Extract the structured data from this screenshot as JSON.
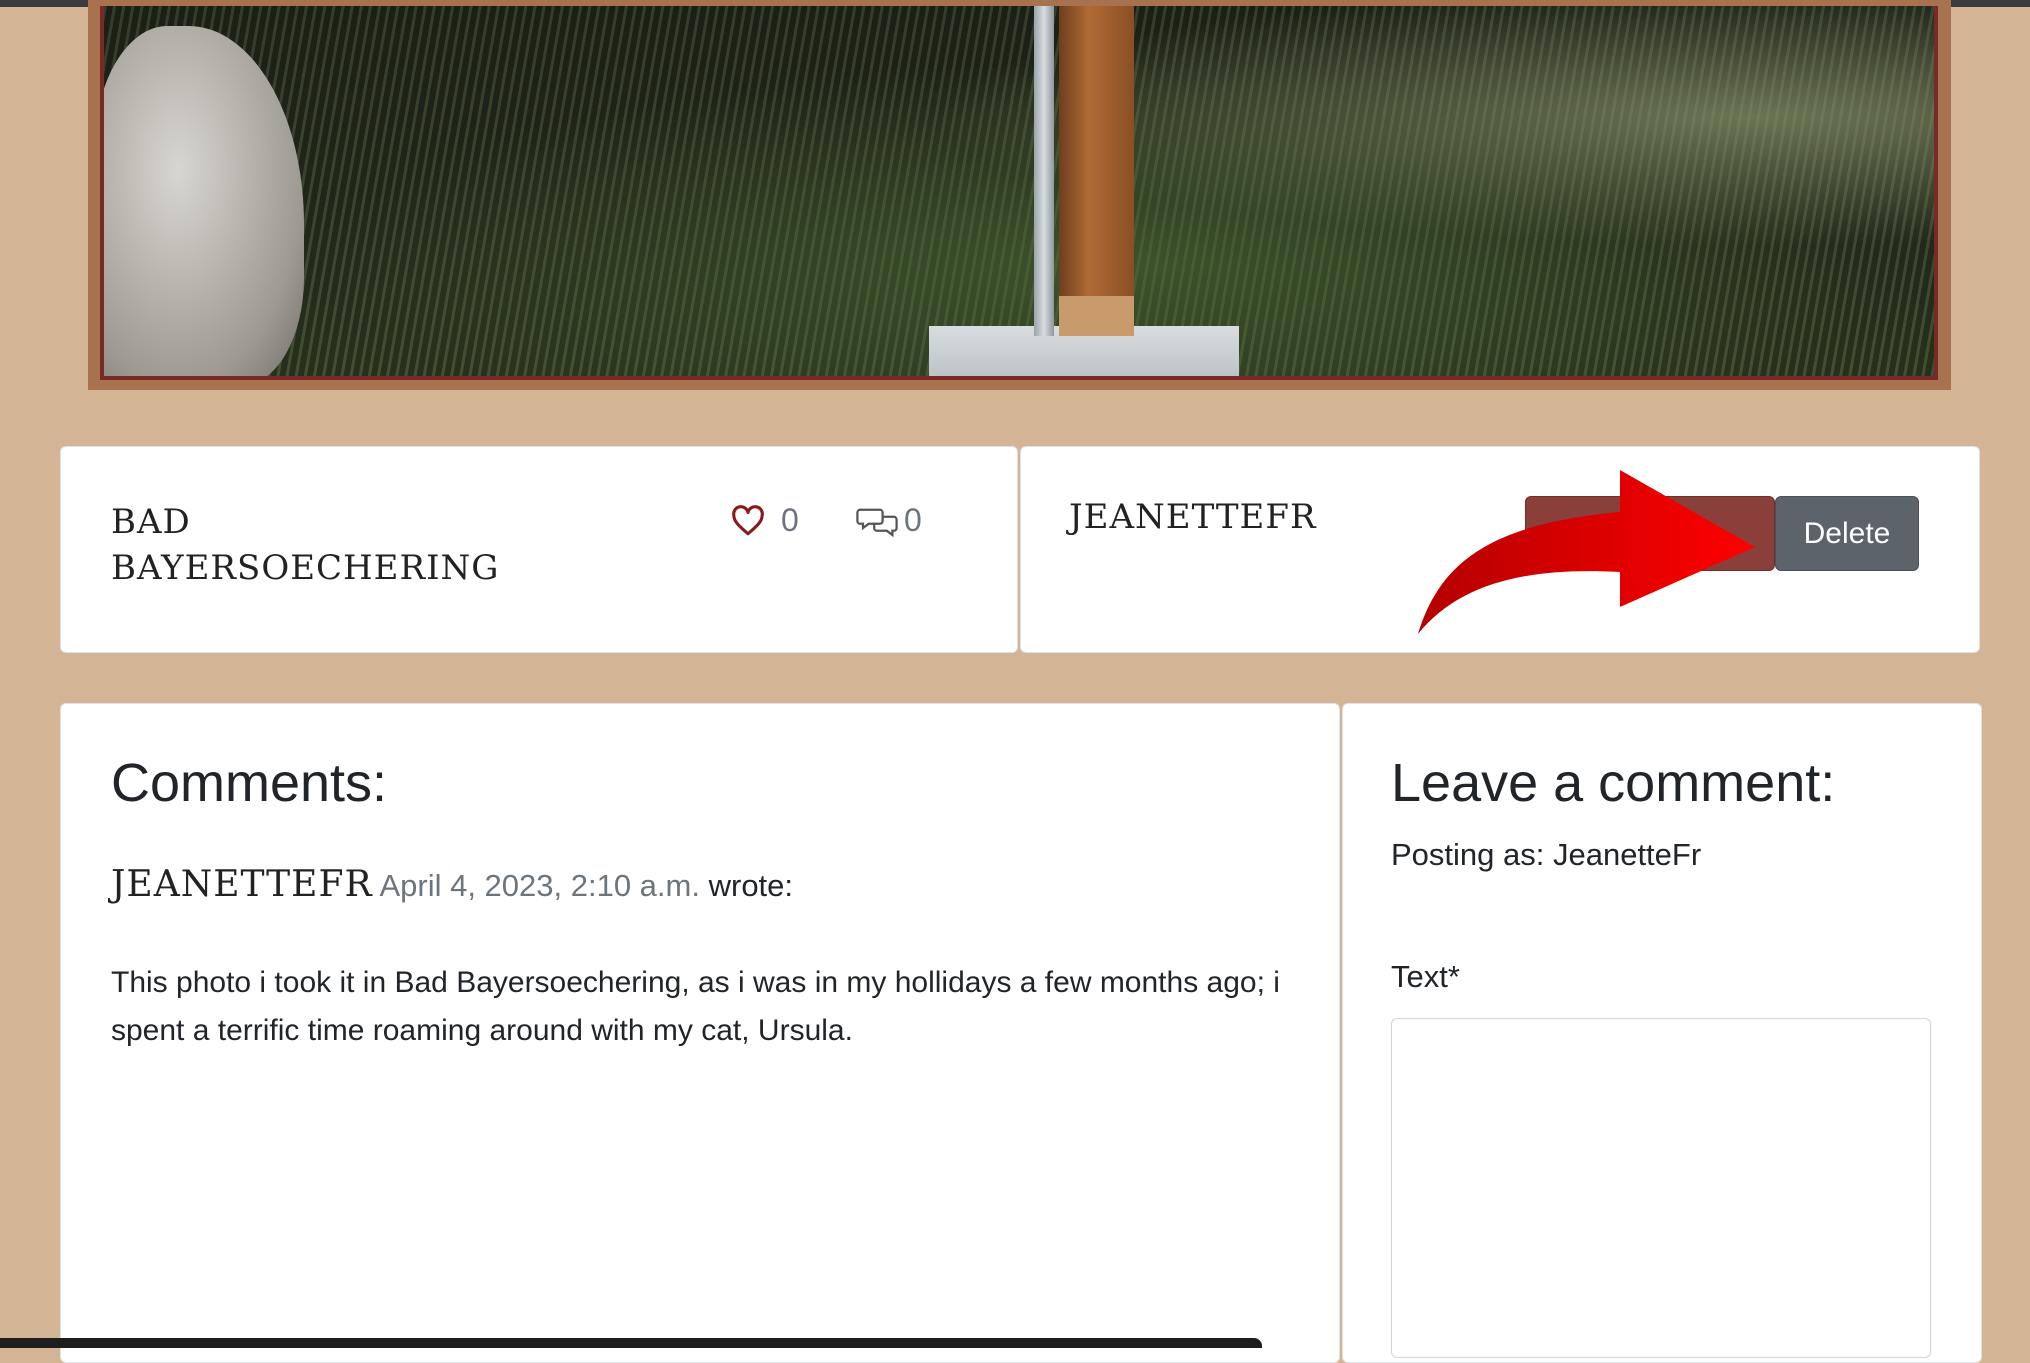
{
  "post": {
    "title": "Bad Bayersoechering",
    "likes": "0",
    "comments": "0",
    "author": "JeanetteFr",
    "edit_label": "Edit",
    "delete_label": "Delete"
  },
  "comments_section": {
    "heading": "Comments:",
    "items": [
      {
        "author": "JeanetteFr",
        "date": "April 4, 2023, 2:10 a.m.",
        "wrote": "wrote:",
        "text": "This photo i took it in Bad Bayersoechering, as i was in my hollidays a few months ago; i spent a terrific time roaming around with my cat, Ursula."
      }
    ]
  },
  "comment_form": {
    "heading": "Leave a comment:",
    "posting_as": "Posting as: JeanetteFr",
    "text_label": "Text*",
    "text_value": ""
  },
  "colors": {
    "page_bg": "#d3b596",
    "accent": "#8a3f3a",
    "delete_button": "#5c636a",
    "annotation_arrow": "#e50000"
  },
  "icons": {
    "like": "heart-icon",
    "comments": "chat-bubbles-icon",
    "annotation": "red-arrow-icon"
  }
}
